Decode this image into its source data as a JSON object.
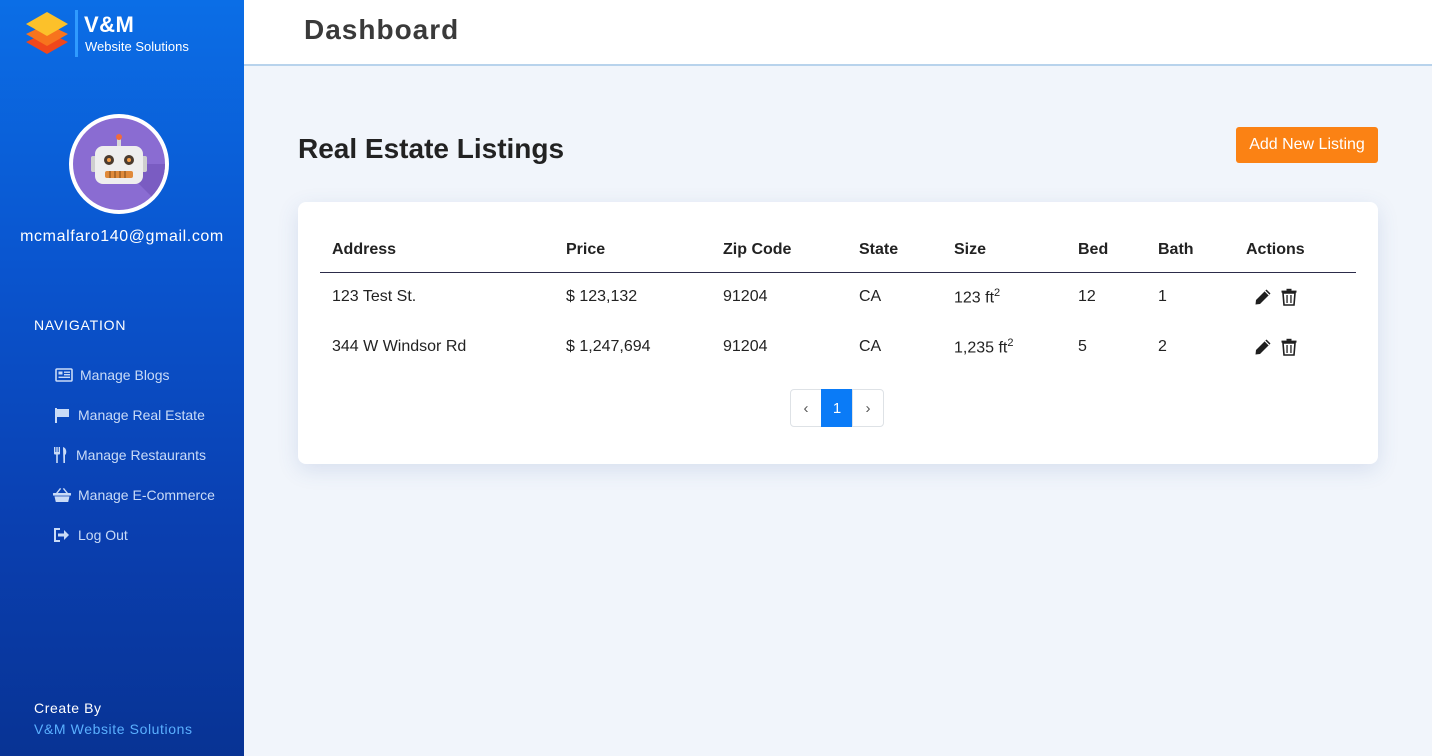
{
  "brand": {
    "name": "V&M",
    "subtitle": "Website Solutions"
  },
  "user": {
    "email": "mcmalfaro140@gmail.com"
  },
  "navigation": {
    "heading": "NAVIGATION",
    "items": [
      {
        "label": "Manage Blogs",
        "icon": "newspaper-icon"
      },
      {
        "label": "Manage Real Estate",
        "icon": "flag-icon"
      },
      {
        "label": "Manage Restaurants",
        "icon": "utensils-icon"
      },
      {
        "label": "Manage E-Commerce",
        "icon": "shopping-basket-icon"
      },
      {
        "label": "Log Out",
        "icon": "sign-out-icon"
      }
    ]
  },
  "footer": {
    "label": "Create By",
    "link": "V&M Website Solutions"
  },
  "header": {
    "title": "Dashboard"
  },
  "main": {
    "title": "Real Estate Listings",
    "add_button": "Add New Listing",
    "table": {
      "headers": [
        "Address",
        "Price",
        "Zip Code",
        "State",
        "Size",
        "Bed",
        "Bath",
        "Actions"
      ],
      "rows": [
        {
          "address": "123 Test St.",
          "price": "$ 123,132",
          "zip": "91204",
          "state": "CA",
          "size": "123 ft",
          "size_unit_exp": "2",
          "bed": "12",
          "bath": "1"
        },
        {
          "address": "344 W Windsor Rd",
          "price": "$ 1,247,694",
          "zip": "91204",
          "state": "CA",
          "size": "1,235 ft",
          "size_unit_exp": "2",
          "bed": "5",
          "bath": "2"
        }
      ]
    },
    "pagination": {
      "prev": "‹",
      "current": "1",
      "next": "›"
    }
  },
  "colors": {
    "accent": "#fb8214",
    "primary": "#0a7bf7",
    "sidebar_top": "#0b6ee6",
    "sidebar_bottom": "#083394"
  }
}
